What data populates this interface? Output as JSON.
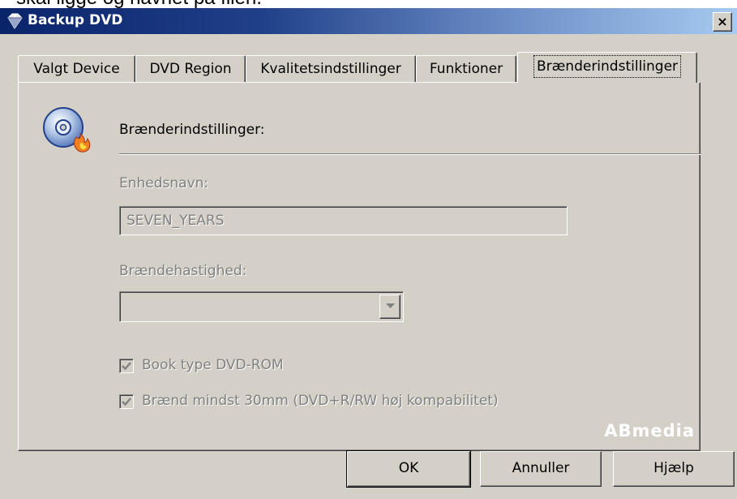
{
  "bleed_text": "skal ligge og navnet på filen.",
  "window": {
    "title": "Backup DVD",
    "close_glyph": "×",
    "title_icon": "gem-icon"
  },
  "tabs": [
    {
      "label": "Valgt Device",
      "active": false
    },
    {
      "label": "DVD Region",
      "active": false
    },
    {
      "label": "Kvalitetsindstillinger",
      "active": false
    },
    {
      "label": "Funktioner",
      "active": false
    },
    {
      "label": "Brænderindstillinger",
      "active": true
    }
  ],
  "panel": {
    "icon": "cd-burner-icon",
    "section_title": "Brænderindstillinger:",
    "device_name_label": "Enhedsnavn:",
    "device_name_value": "SEVEN_YEARS",
    "burn_speed_label": "Brændehastighed:",
    "burn_speed_value": "",
    "checkboxes": [
      {
        "label": "Book type DVD-ROM",
        "checked": true,
        "enabled": false
      },
      {
        "label": "Brænd mindst 30mm (DVD+R/RW høj kompabilitet)",
        "checked": true,
        "enabled": false
      }
    ],
    "watermark": "ABmedia"
  },
  "buttons": {
    "ok": "OK",
    "cancel": "Annuller",
    "help": "Hjælp"
  },
  "colors": {
    "dialog_face": "#d4d0c8",
    "title_active_start": "#0a246a",
    "title_active_end": "#a6caf0",
    "disabled_text": "#808080"
  }
}
